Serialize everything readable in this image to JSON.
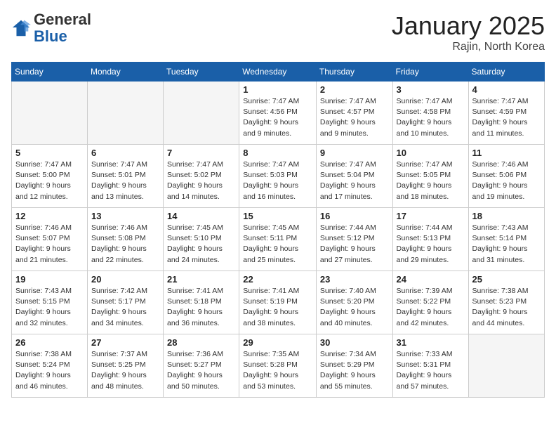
{
  "logo": {
    "general": "General",
    "blue": "Blue"
  },
  "header": {
    "month": "January 2025",
    "location": "Rajin, North Korea"
  },
  "weekdays": [
    "Sunday",
    "Monday",
    "Tuesday",
    "Wednesday",
    "Thursday",
    "Friday",
    "Saturday"
  ],
  "weeks": [
    [
      {
        "day": "",
        "info": ""
      },
      {
        "day": "",
        "info": ""
      },
      {
        "day": "",
        "info": ""
      },
      {
        "day": "1",
        "info": "Sunrise: 7:47 AM\nSunset: 4:56 PM\nDaylight: 9 hours\nand 9 minutes."
      },
      {
        "day": "2",
        "info": "Sunrise: 7:47 AM\nSunset: 4:57 PM\nDaylight: 9 hours\nand 9 minutes."
      },
      {
        "day": "3",
        "info": "Sunrise: 7:47 AM\nSunset: 4:58 PM\nDaylight: 9 hours\nand 10 minutes."
      },
      {
        "day": "4",
        "info": "Sunrise: 7:47 AM\nSunset: 4:59 PM\nDaylight: 9 hours\nand 11 minutes."
      }
    ],
    [
      {
        "day": "5",
        "info": "Sunrise: 7:47 AM\nSunset: 5:00 PM\nDaylight: 9 hours\nand 12 minutes."
      },
      {
        "day": "6",
        "info": "Sunrise: 7:47 AM\nSunset: 5:01 PM\nDaylight: 9 hours\nand 13 minutes."
      },
      {
        "day": "7",
        "info": "Sunrise: 7:47 AM\nSunset: 5:02 PM\nDaylight: 9 hours\nand 14 minutes."
      },
      {
        "day": "8",
        "info": "Sunrise: 7:47 AM\nSunset: 5:03 PM\nDaylight: 9 hours\nand 16 minutes."
      },
      {
        "day": "9",
        "info": "Sunrise: 7:47 AM\nSunset: 5:04 PM\nDaylight: 9 hours\nand 17 minutes."
      },
      {
        "day": "10",
        "info": "Sunrise: 7:47 AM\nSunset: 5:05 PM\nDaylight: 9 hours\nand 18 minutes."
      },
      {
        "day": "11",
        "info": "Sunrise: 7:46 AM\nSunset: 5:06 PM\nDaylight: 9 hours\nand 19 minutes."
      }
    ],
    [
      {
        "day": "12",
        "info": "Sunrise: 7:46 AM\nSunset: 5:07 PM\nDaylight: 9 hours\nand 21 minutes."
      },
      {
        "day": "13",
        "info": "Sunrise: 7:46 AM\nSunset: 5:08 PM\nDaylight: 9 hours\nand 22 minutes."
      },
      {
        "day": "14",
        "info": "Sunrise: 7:45 AM\nSunset: 5:10 PM\nDaylight: 9 hours\nand 24 minutes."
      },
      {
        "day": "15",
        "info": "Sunrise: 7:45 AM\nSunset: 5:11 PM\nDaylight: 9 hours\nand 25 minutes."
      },
      {
        "day": "16",
        "info": "Sunrise: 7:44 AM\nSunset: 5:12 PM\nDaylight: 9 hours\nand 27 minutes."
      },
      {
        "day": "17",
        "info": "Sunrise: 7:44 AM\nSunset: 5:13 PM\nDaylight: 9 hours\nand 29 minutes."
      },
      {
        "day": "18",
        "info": "Sunrise: 7:43 AM\nSunset: 5:14 PM\nDaylight: 9 hours\nand 31 minutes."
      }
    ],
    [
      {
        "day": "19",
        "info": "Sunrise: 7:43 AM\nSunset: 5:15 PM\nDaylight: 9 hours\nand 32 minutes."
      },
      {
        "day": "20",
        "info": "Sunrise: 7:42 AM\nSunset: 5:17 PM\nDaylight: 9 hours\nand 34 minutes."
      },
      {
        "day": "21",
        "info": "Sunrise: 7:41 AM\nSunset: 5:18 PM\nDaylight: 9 hours\nand 36 minutes."
      },
      {
        "day": "22",
        "info": "Sunrise: 7:41 AM\nSunset: 5:19 PM\nDaylight: 9 hours\nand 38 minutes."
      },
      {
        "day": "23",
        "info": "Sunrise: 7:40 AM\nSunset: 5:20 PM\nDaylight: 9 hours\nand 40 minutes."
      },
      {
        "day": "24",
        "info": "Sunrise: 7:39 AM\nSunset: 5:22 PM\nDaylight: 9 hours\nand 42 minutes."
      },
      {
        "day": "25",
        "info": "Sunrise: 7:38 AM\nSunset: 5:23 PM\nDaylight: 9 hours\nand 44 minutes."
      }
    ],
    [
      {
        "day": "26",
        "info": "Sunrise: 7:38 AM\nSunset: 5:24 PM\nDaylight: 9 hours\nand 46 minutes."
      },
      {
        "day": "27",
        "info": "Sunrise: 7:37 AM\nSunset: 5:25 PM\nDaylight: 9 hours\nand 48 minutes."
      },
      {
        "day": "28",
        "info": "Sunrise: 7:36 AM\nSunset: 5:27 PM\nDaylight: 9 hours\nand 50 minutes."
      },
      {
        "day": "29",
        "info": "Sunrise: 7:35 AM\nSunset: 5:28 PM\nDaylight: 9 hours\nand 53 minutes."
      },
      {
        "day": "30",
        "info": "Sunrise: 7:34 AM\nSunset: 5:29 PM\nDaylight: 9 hours\nand 55 minutes."
      },
      {
        "day": "31",
        "info": "Sunrise: 7:33 AM\nSunset: 5:31 PM\nDaylight: 9 hours\nand 57 minutes."
      },
      {
        "day": "",
        "info": ""
      }
    ]
  ]
}
